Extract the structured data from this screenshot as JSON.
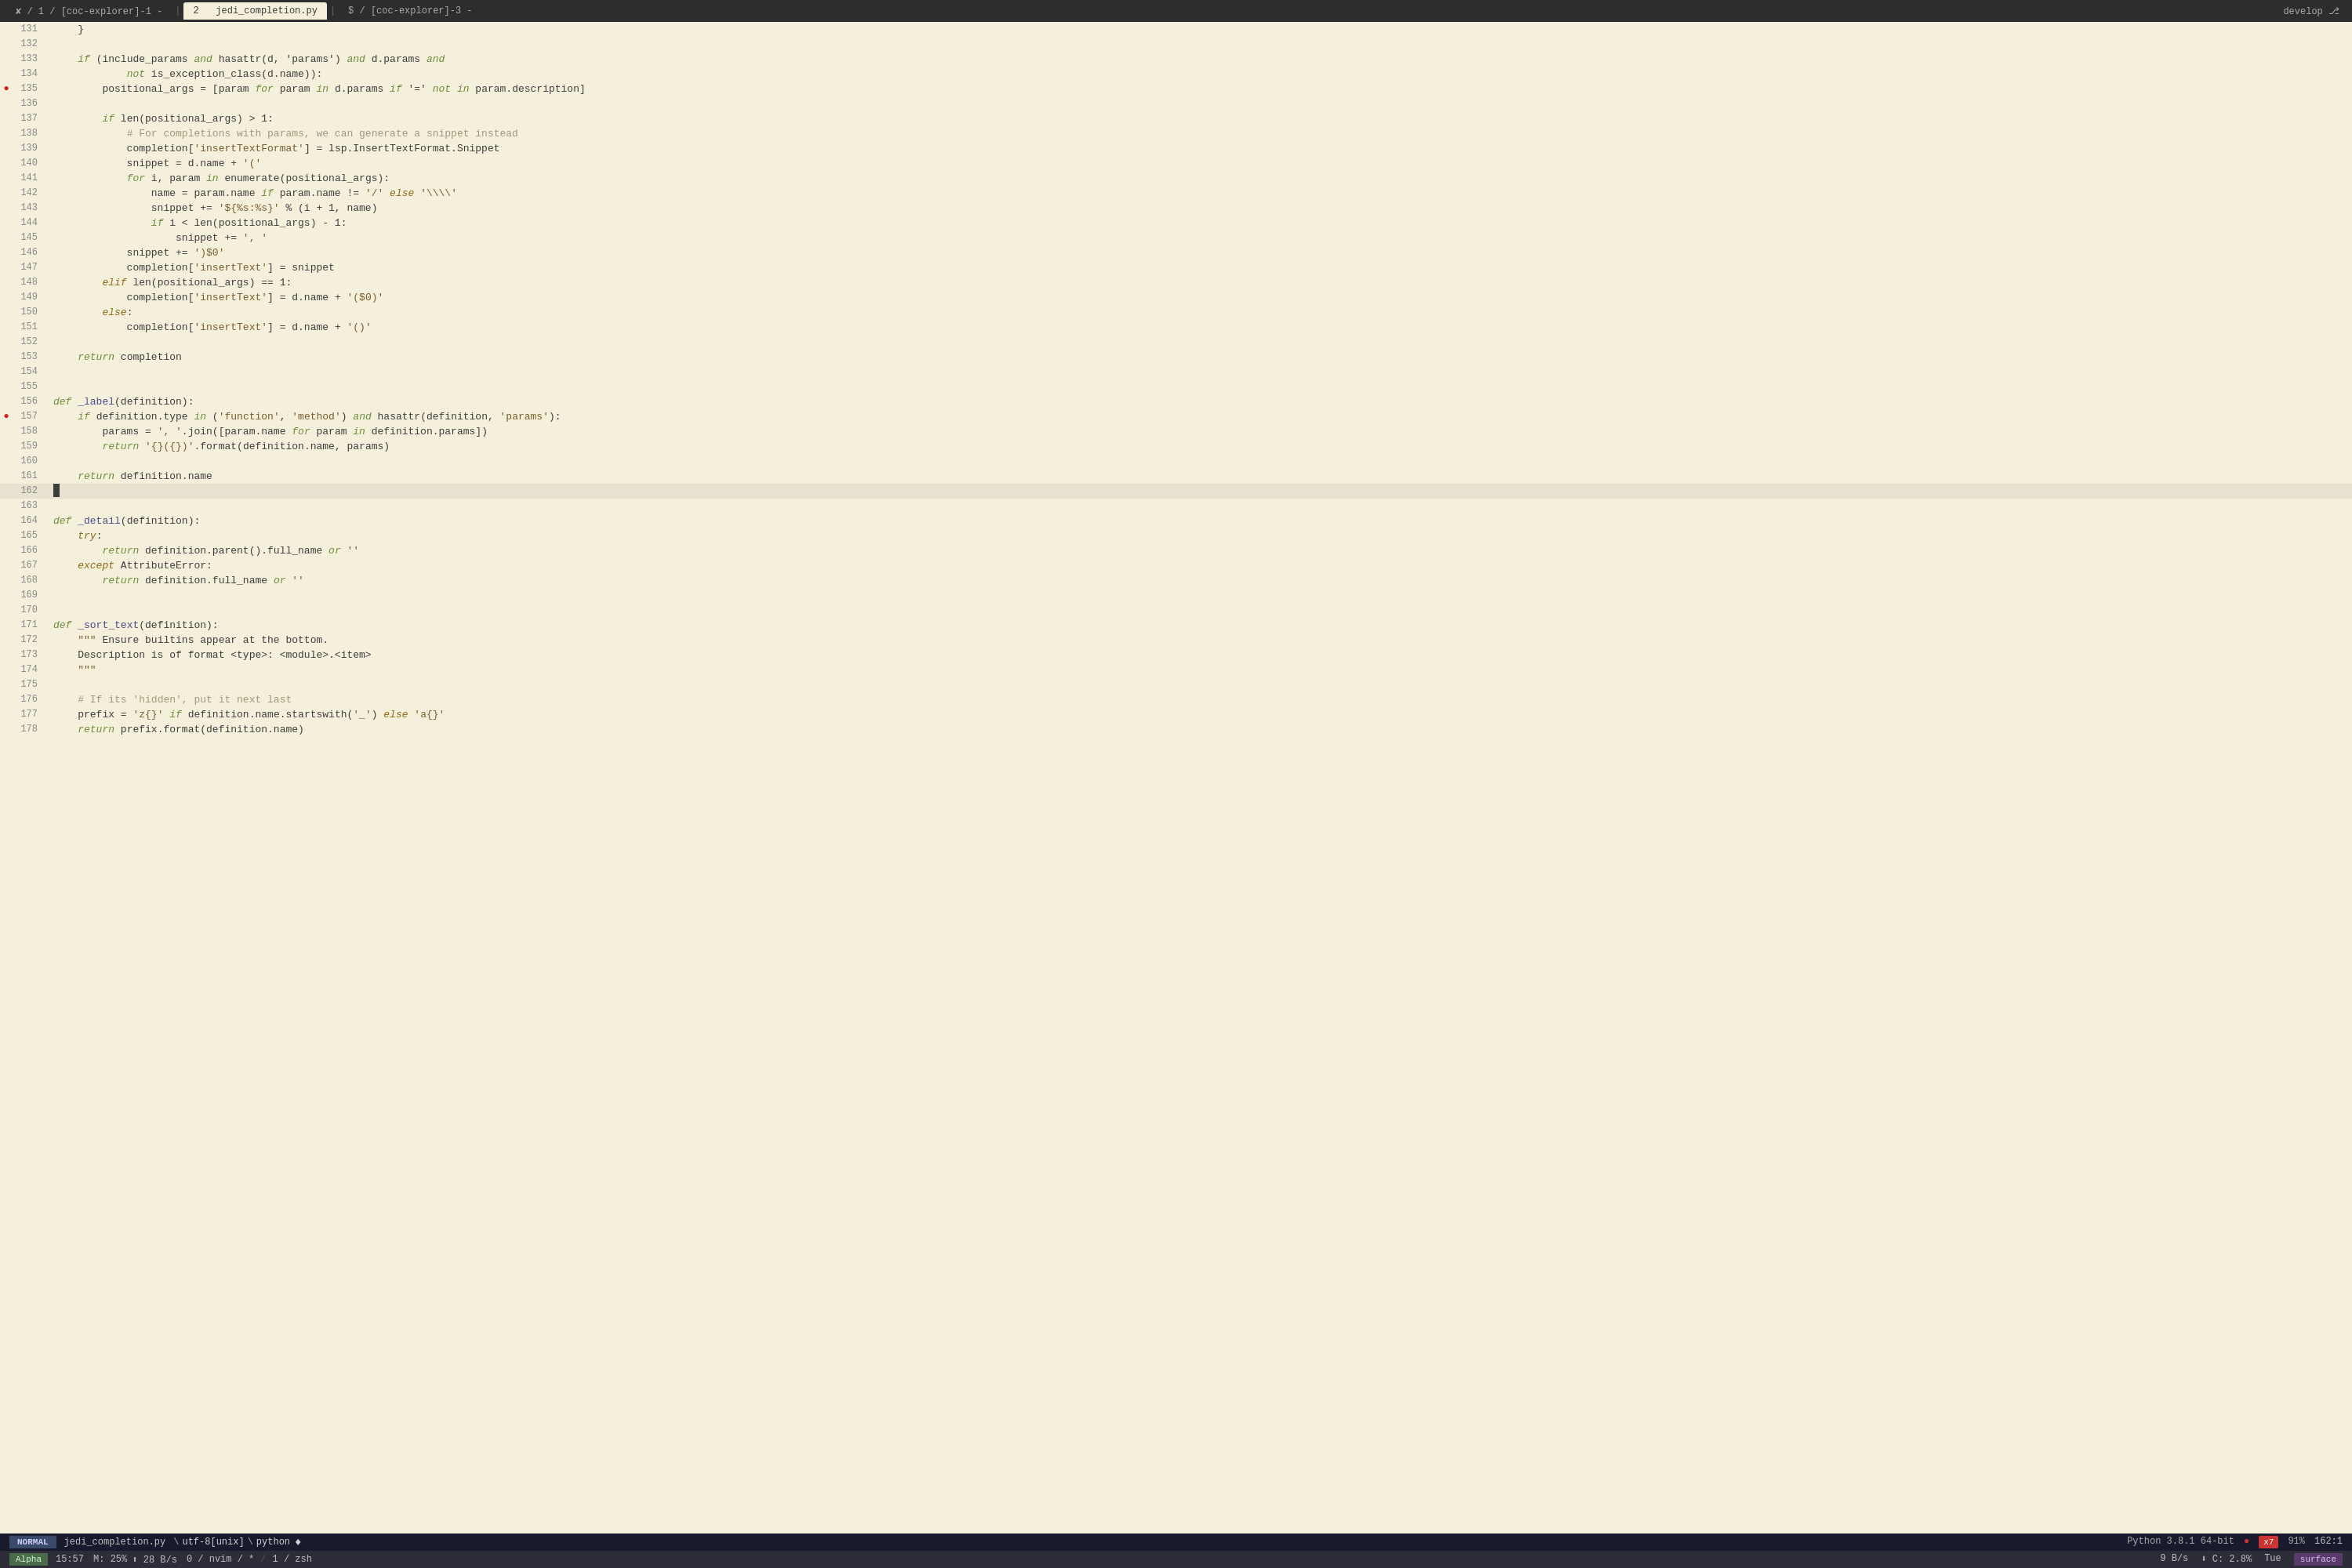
{
  "tabs": [
    {
      "label": "✘ / 1 / [coc-explorer]-1 -",
      "active": false
    },
    {
      "label": "2",
      "active": true,
      "file": "jedi_completion.py"
    },
    {
      "label": "$ / [coc-explorer]-3 -",
      "active": false
    }
  ],
  "branch": "develop ⎇",
  "lines": [
    {
      "num": 131,
      "error": false,
      "current": false,
      "tokens": [
        {
          "t": "plain",
          "v": "    }"
        }
      ]
    },
    {
      "num": 132,
      "error": false,
      "current": false,
      "tokens": []
    },
    {
      "num": 133,
      "error": false,
      "current": false,
      "tokens": [
        {
          "t": "plain",
          "v": "    "
        },
        {
          "t": "kw",
          "v": "if"
        },
        {
          "t": "plain",
          "v": " (include_params "
        },
        {
          "t": "kw",
          "v": "and"
        },
        {
          "t": "plain",
          "v": " hasattr(d, 'params') "
        },
        {
          "t": "kw",
          "v": "and"
        },
        {
          "t": "plain",
          "v": " d.params "
        },
        {
          "t": "kw",
          "v": "and"
        }
      ]
    },
    {
      "num": 134,
      "error": false,
      "current": false,
      "tokens": [
        {
          "t": "plain",
          "v": "            "
        },
        {
          "t": "kw",
          "v": "not"
        },
        {
          "t": "plain",
          "v": " is_exception_class(d.name)):"
        }
      ]
    },
    {
      "num": 135,
      "error": true,
      "current": false,
      "tokens": [
        {
          "t": "plain",
          "v": "        positional_args = [param "
        },
        {
          "t": "kw",
          "v": "for"
        },
        {
          "t": "plain",
          "v": " param "
        },
        {
          "t": "kw",
          "v": "in"
        },
        {
          "t": "plain",
          "v": " d.params "
        },
        {
          "t": "kw",
          "v": "if"
        },
        {
          "t": "plain",
          "v": " '=' "
        },
        {
          "t": "kw",
          "v": "not"
        },
        {
          "t": "plain",
          "v": " "
        },
        {
          "t": "kw",
          "v": "in"
        },
        {
          "t": "plain",
          "v": " param.description]"
        }
      ]
    },
    {
      "num": 136,
      "error": false,
      "current": false,
      "tokens": []
    },
    {
      "num": 137,
      "error": false,
      "current": false,
      "tokens": [
        {
          "t": "plain",
          "v": "        "
        },
        {
          "t": "kw",
          "v": "if"
        },
        {
          "t": "plain",
          "v": " len(positional_args) > 1:"
        }
      ]
    },
    {
      "num": 138,
      "error": false,
      "current": false,
      "tokens": [
        {
          "t": "plain",
          "v": "            "
        },
        {
          "t": "cmt",
          "v": "# For completions with params, we can generate a snippet instead"
        }
      ]
    },
    {
      "num": 139,
      "error": false,
      "current": false,
      "tokens": [
        {
          "t": "plain",
          "v": "            completion["
        },
        {
          "t": "str",
          "v": "'insertTextFormat'"
        },
        {
          "t": "plain",
          "v": "] = lsp.InsertTextFormat.Snippet"
        }
      ]
    },
    {
      "num": 140,
      "error": false,
      "current": false,
      "tokens": [
        {
          "t": "plain",
          "v": "            snippet = d.name + "
        },
        {
          "t": "str",
          "v": "'('"
        }
      ]
    },
    {
      "num": 141,
      "error": false,
      "current": false,
      "tokens": [
        {
          "t": "plain",
          "v": "            "
        },
        {
          "t": "kw",
          "v": "for"
        },
        {
          "t": "plain",
          "v": " i, param "
        },
        {
          "t": "kw",
          "v": "in"
        },
        {
          "t": "plain",
          "v": " enumerate(positional_args):"
        }
      ]
    },
    {
      "num": 142,
      "error": false,
      "current": false,
      "tokens": [
        {
          "t": "plain",
          "v": "                name = param.name "
        },
        {
          "t": "kw",
          "v": "if"
        },
        {
          "t": "plain",
          "v": " param.name != "
        },
        {
          "t": "str",
          "v": "'/'"
        },
        {
          "t": "plain",
          "v": " "
        },
        {
          "t": "kw2",
          "v": "else"
        },
        {
          "t": "plain",
          "v": " "
        },
        {
          "t": "str",
          "v": "'\\\\\\\\'"
        }
      ]
    },
    {
      "num": 143,
      "error": false,
      "current": false,
      "tokens": [
        {
          "t": "plain",
          "v": "                snippet += "
        },
        {
          "t": "str",
          "v": "'${%s:%s}'"
        },
        {
          "t": "plain",
          "v": " % (i + 1, name)"
        }
      ]
    },
    {
      "num": 144,
      "error": false,
      "current": false,
      "tokens": [
        {
          "t": "plain",
          "v": "                "
        },
        {
          "t": "kw",
          "v": "if"
        },
        {
          "t": "plain",
          "v": " i < len(positional_args) - 1:"
        }
      ]
    },
    {
      "num": 145,
      "error": false,
      "current": false,
      "tokens": [
        {
          "t": "plain",
          "v": "                    snippet += "
        },
        {
          "t": "str",
          "v": "', '"
        }
      ]
    },
    {
      "num": 146,
      "error": false,
      "current": false,
      "tokens": [
        {
          "t": "plain",
          "v": "            snippet += "
        },
        {
          "t": "str",
          "v": "')$0'"
        }
      ]
    },
    {
      "num": 147,
      "error": false,
      "current": false,
      "tokens": [
        {
          "t": "plain",
          "v": "            completion["
        },
        {
          "t": "str",
          "v": "'insertText'"
        },
        {
          "t": "plain",
          "v": "] = snippet"
        }
      ]
    },
    {
      "num": 148,
      "error": false,
      "current": false,
      "tokens": [
        {
          "t": "plain",
          "v": "        "
        },
        {
          "t": "kw2",
          "v": "elif"
        },
        {
          "t": "plain",
          "v": " len(positional_args) == 1:"
        }
      ]
    },
    {
      "num": 149,
      "error": false,
      "current": false,
      "tokens": [
        {
          "t": "plain",
          "v": "            completion["
        },
        {
          "t": "str",
          "v": "'insertText'"
        },
        {
          "t": "plain",
          "v": "] = d.name + "
        },
        {
          "t": "str",
          "v": "'($0)'"
        }
      ]
    },
    {
      "num": 150,
      "error": false,
      "current": false,
      "tokens": [
        {
          "t": "plain",
          "v": "        "
        },
        {
          "t": "kw2",
          "v": "else"
        },
        {
          "t": "plain",
          "v": ":"
        }
      ]
    },
    {
      "num": 151,
      "error": false,
      "current": false,
      "tokens": [
        {
          "t": "plain",
          "v": "            completion["
        },
        {
          "t": "str",
          "v": "'insertText'"
        },
        {
          "t": "plain",
          "v": "] = d.name + "
        },
        {
          "t": "str",
          "v": "'()'"
        }
      ]
    },
    {
      "num": 152,
      "error": false,
      "current": false,
      "tokens": []
    },
    {
      "num": 153,
      "error": false,
      "current": false,
      "tokens": [
        {
          "t": "plain",
          "v": "    "
        },
        {
          "t": "kw",
          "v": "return"
        },
        {
          "t": "plain",
          "v": " completion"
        }
      ]
    },
    {
      "num": 154,
      "error": false,
      "current": false,
      "tokens": []
    },
    {
      "num": 155,
      "error": false,
      "current": false,
      "tokens": []
    },
    {
      "num": 156,
      "error": false,
      "current": false,
      "tokens": [
        {
          "t": "kw",
          "v": "def"
        },
        {
          "t": "plain",
          "v": " "
        },
        {
          "t": "fn",
          "v": "_label"
        },
        {
          "t": "plain",
          "v": "(definition):"
        }
      ]
    },
    {
      "num": 157,
      "error": true,
      "current": false,
      "tokens": [
        {
          "t": "plain",
          "v": "    "
        },
        {
          "t": "kw",
          "v": "if"
        },
        {
          "t": "plain",
          "v": " definition.type "
        },
        {
          "t": "kw",
          "v": "in"
        },
        {
          "t": "plain",
          "v": " ("
        },
        {
          "t": "str",
          "v": "'function'"
        },
        {
          "t": "plain",
          "v": ", "
        },
        {
          "t": "str",
          "v": "'method'"
        },
        {
          "t": "plain",
          "v": ") "
        },
        {
          "t": "kw",
          "v": "and"
        },
        {
          "t": "plain",
          "v": " hasattr(definition, "
        },
        {
          "t": "str",
          "v": "'params'"
        },
        {
          "t": "plain",
          "v": "):"
        }
      ]
    },
    {
      "num": 158,
      "error": false,
      "current": false,
      "tokens": [
        {
          "t": "plain",
          "v": "        params = "
        },
        {
          "t": "str",
          "v": "', '"
        },
        {
          "t": "plain",
          "v": ".join([param.name "
        },
        {
          "t": "kw",
          "v": "for"
        },
        {
          "t": "plain",
          "v": " param "
        },
        {
          "t": "kw",
          "v": "in"
        },
        {
          "t": "plain",
          "v": " definition.params])"
        }
      ]
    },
    {
      "num": 159,
      "error": false,
      "current": false,
      "tokens": [
        {
          "t": "plain",
          "v": "        "
        },
        {
          "t": "kw",
          "v": "return"
        },
        {
          "t": "plain",
          "v": " "
        },
        {
          "t": "str",
          "v": "'{}({})'"
        },
        {
          "t": "plain",
          "v": ".format(definition.name, params)"
        }
      ]
    },
    {
      "num": 160,
      "error": false,
      "current": false,
      "tokens": []
    },
    {
      "num": 161,
      "error": false,
      "current": false,
      "tokens": [
        {
          "t": "plain",
          "v": "    "
        },
        {
          "t": "kw",
          "v": "return"
        },
        {
          "t": "plain",
          "v": " definition.name"
        }
      ]
    },
    {
      "num": 162,
      "error": false,
      "current": true,
      "tokens": []
    },
    {
      "num": 163,
      "error": false,
      "current": false,
      "tokens": []
    },
    {
      "num": 164,
      "error": false,
      "current": false,
      "tokens": [
        {
          "t": "kw",
          "v": "def"
        },
        {
          "t": "plain",
          "v": " "
        },
        {
          "t": "fn",
          "v": "_detail"
        },
        {
          "t": "plain",
          "v": "(definition):"
        }
      ]
    },
    {
      "num": 165,
      "error": false,
      "current": false,
      "tokens": [
        {
          "t": "plain",
          "v": "    "
        },
        {
          "t": "kw2",
          "v": "try"
        },
        {
          "t": "plain",
          "v": ":"
        }
      ]
    },
    {
      "num": 166,
      "error": false,
      "current": false,
      "tokens": [
        {
          "t": "plain",
          "v": "        "
        },
        {
          "t": "kw",
          "v": "return"
        },
        {
          "t": "plain",
          "v": " definition.parent().full_name "
        },
        {
          "t": "kw",
          "v": "or"
        },
        {
          "t": "plain",
          "v": " "
        },
        {
          "t": "str",
          "v": "''"
        }
      ]
    },
    {
      "num": 167,
      "error": false,
      "current": false,
      "tokens": [
        {
          "t": "plain",
          "v": "    "
        },
        {
          "t": "kw2",
          "v": "except"
        },
        {
          "t": "plain",
          "v": " AttributeError:"
        }
      ]
    },
    {
      "num": 168,
      "error": false,
      "current": false,
      "tokens": [
        {
          "t": "plain",
          "v": "        "
        },
        {
          "t": "kw",
          "v": "return"
        },
        {
          "t": "plain",
          "v": " definition.full_name "
        },
        {
          "t": "kw",
          "v": "or"
        },
        {
          "t": "plain",
          "v": " "
        },
        {
          "t": "str",
          "v": "''"
        }
      ]
    },
    {
      "num": 169,
      "error": false,
      "current": false,
      "tokens": []
    },
    {
      "num": 170,
      "error": false,
      "current": false,
      "tokens": []
    },
    {
      "num": 171,
      "error": false,
      "current": false,
      "tokens": [
        {
          "t": "kw",
          "v": "def"
        },
        {
          "t": "plain",
          "v": " "
        },
        {
          "t": "fn",
          "v": "_sort_text"
        },
        {
          "t": "plain",
          "v": "(definition):"
        }
      ]
    },
    {
      "num": 172,
      "error": false,
      "current": false,
      "tokens": [
        {
          "t": "plain",
          "v": "    "
        },
        {
          "t": "str",
          "v": "\"\"\""
        },
        {
          "t": "plain",
          "v": " Ensure builtins appear at the bottom."
        }
      ]
    },
    {
      "num": 173,
      "error": false,
      "current": false,
      "tokens": [
        {
          "t": "plain",
          "v": "    Description is of format <type>: <module>.<item>"
        }
      ]
    },
    {
      "num": 174,
      "error": false,
      "current": false,
      "tokens": [
        {
          "t": "plain",
          "v": "    "
        },
        {
          "t": "str",
          "v": "\"\"\""
        }
      ]
    },
    {
      "num": 175,
      "error": false,
      "current": false,
      "tokens": []
    },
    {
      "num": 176,
      "error": false,
      "current": false,
      "tokens": [
        {
          "t": "plain",
          "v": "    "
        },
        {
          "t": "cmt",
          "v": "# If its 'hidden', put it next last"
        }
      ]
    },
    {
      "num": 177,
      "error": false,
      "current": false,
      "tokens": [
        {
          "t": "plain",
          "v": "    prefix = "
        },
        {
          "t": "str",
          "v": "'z{}'"
        },
        {
          "t": "plain",
          "v": " "
        },
        {
          "t": "kw",
          "v": "if"
        },
        {
          "t": "plain",
          "v": " definition.name.startswith("
        },
        {
          "t": "str",
          "v": "'_'"
        },
        {
          "t": "plain",
          "v": ") "
        },
        {
          "t": "kw2",
          "v": "else"
        },
        {
          "t": "plain",
          "v": " "
        },
        {
          "t": "str",
          "v": "'a{}'"
        }
      ]
    },
    {
      "num": 178,
      "error": false,
      "current": false,
      "tokens": [
        {
          "t": "plain",
          "v": "    "
        },
        {
          "t": "kw",
          "v": "return"
        },
        {
          "t": "plain",
          "v": " prefix.format(definition.name)"
        }
      ]
    }
  ],
  "status": {
    "mode": "NORMAL",
    "file": "jedi_completion.py",
    "encoding": "utf-8[unix]",
    "filetype": "python",
    "python_version": "Python 3.8.1 64-bit",
    "error_count": "x7",
    "scroll_pct": "91%",
    "position": "162:1",
    "dot_symbol": "●"
  },
  "bottom": {
    "plugin": "Alpha",
    "time": "15:57",
    "memory": "M: 25%",
    "upload": "⬆ 28 B/s",
    "nvim_status": "0 / nvim / *",
    "jobs": "1 / zsh",
    "network_down": "9 B/s",
    "cpu": "⬇ C: 2.8%",
    "day": "Tue",
    "surface": "surface"
  }
}
